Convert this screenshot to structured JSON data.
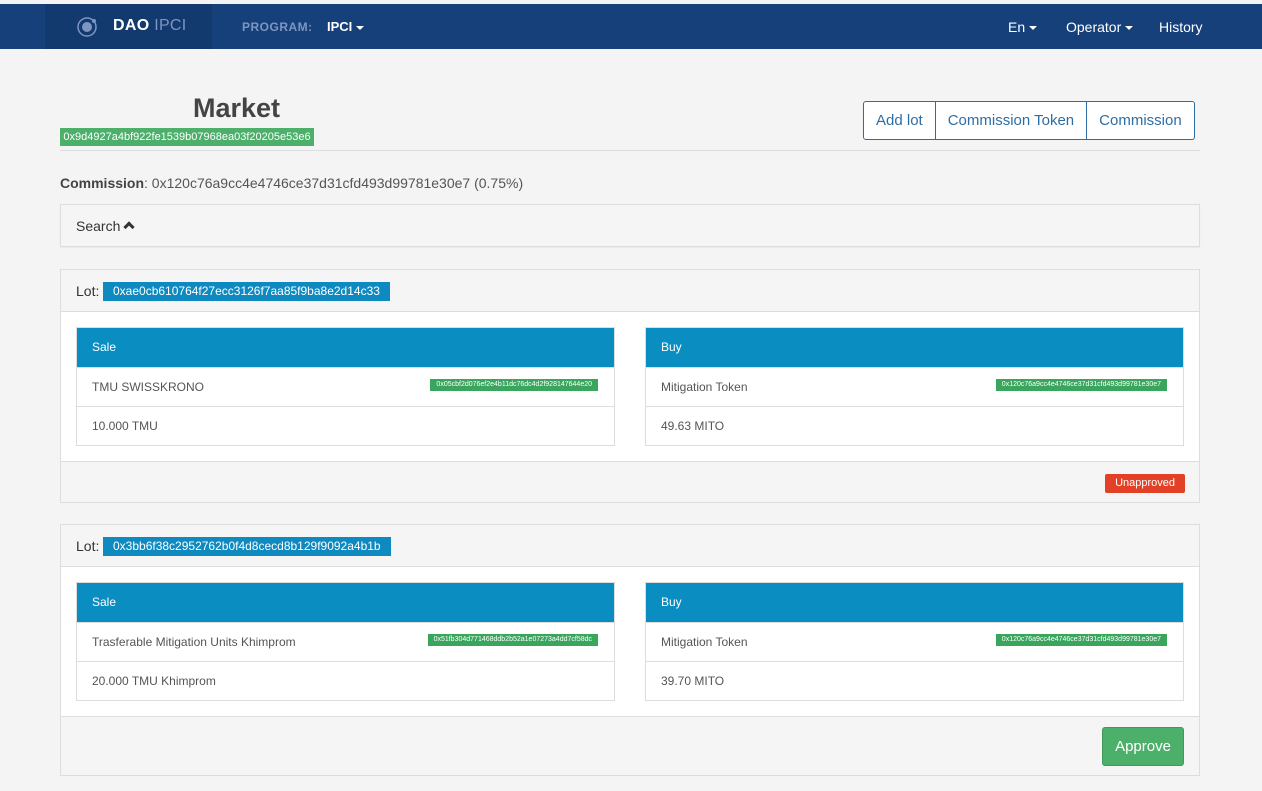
{
  "navbar": {
    "brand_bold": "DAO",
    "brand_light": "IPCI",
    "program_label": "PROGRAM:",
    "program_value": "IPCI",
    "lang": "En",
    "role": "Operator",
    "history": "History"
  },
  "page": {
    "title": "Market",
    "address": "0x9d4927a4bf922fe1539b07968ea03f20205e53e6",
    "buttons": [
      "Add lot",
      "Commission Token",
      "Commission"
    ],
    "commission_label": "Commission",
    "commission_value": ": 0x120c76a9cc4e4746ce37d31cfd493d99781e30e7 (0.75%)",
    "search_label": "Search"
  },
  "lots": [
    {
      "label": "Lot:",
      "id": "0xae0cb610764f27ecc3126f7aa85f9ba8e2d14c33",
      "sale": {
        "header": "Sale",
        "token_name": "TMU SWISSKRONO",
        "token_address": "0x05cbf2d076ef2e4b11dc76dc4d2f928147644e20",
        "amount": "10.000 TMU"
      },
      "buy": {
        "header": "Buy",
        "token_name": "Mitigation Token",
        "token_address": "0x120c76a9cc4e4746ce37d31cfd493d99781e30e7",
        "amount": "49.63 MITO"
      },
      "status": "Unapproved"
    },
    {
      "label": "Lot:",
      "id": "0x3bb6f38c2952762b0f4d8cecd8b129f9092a4b1b",
      "sale": {
        "header": "Sale",
        "token_name": "Trasferable Mitigation Units Khimprom",
        "token_address": "0x51fb304d771468ddb2b52a1e07273a4dd7cf58dc",
        "amount": "20.000 TMU Khimprom"
      },
      "buy": {
        "header": "Buy",
        "token_name": "Mitigation Token",
        "token_address": "0x120c76a9cc4e4746ce37d31cfd493d99781e30e7",
        "amount": "39.70 MITO"
      },
      "action": "Approve"
    }
  ],
  "colors": {
    "navbar": "#15407a",
    "accent_blue": "#0a8dc0",
    "success": "#4caf6a",
    "danger": "#e34127"
  }
}
